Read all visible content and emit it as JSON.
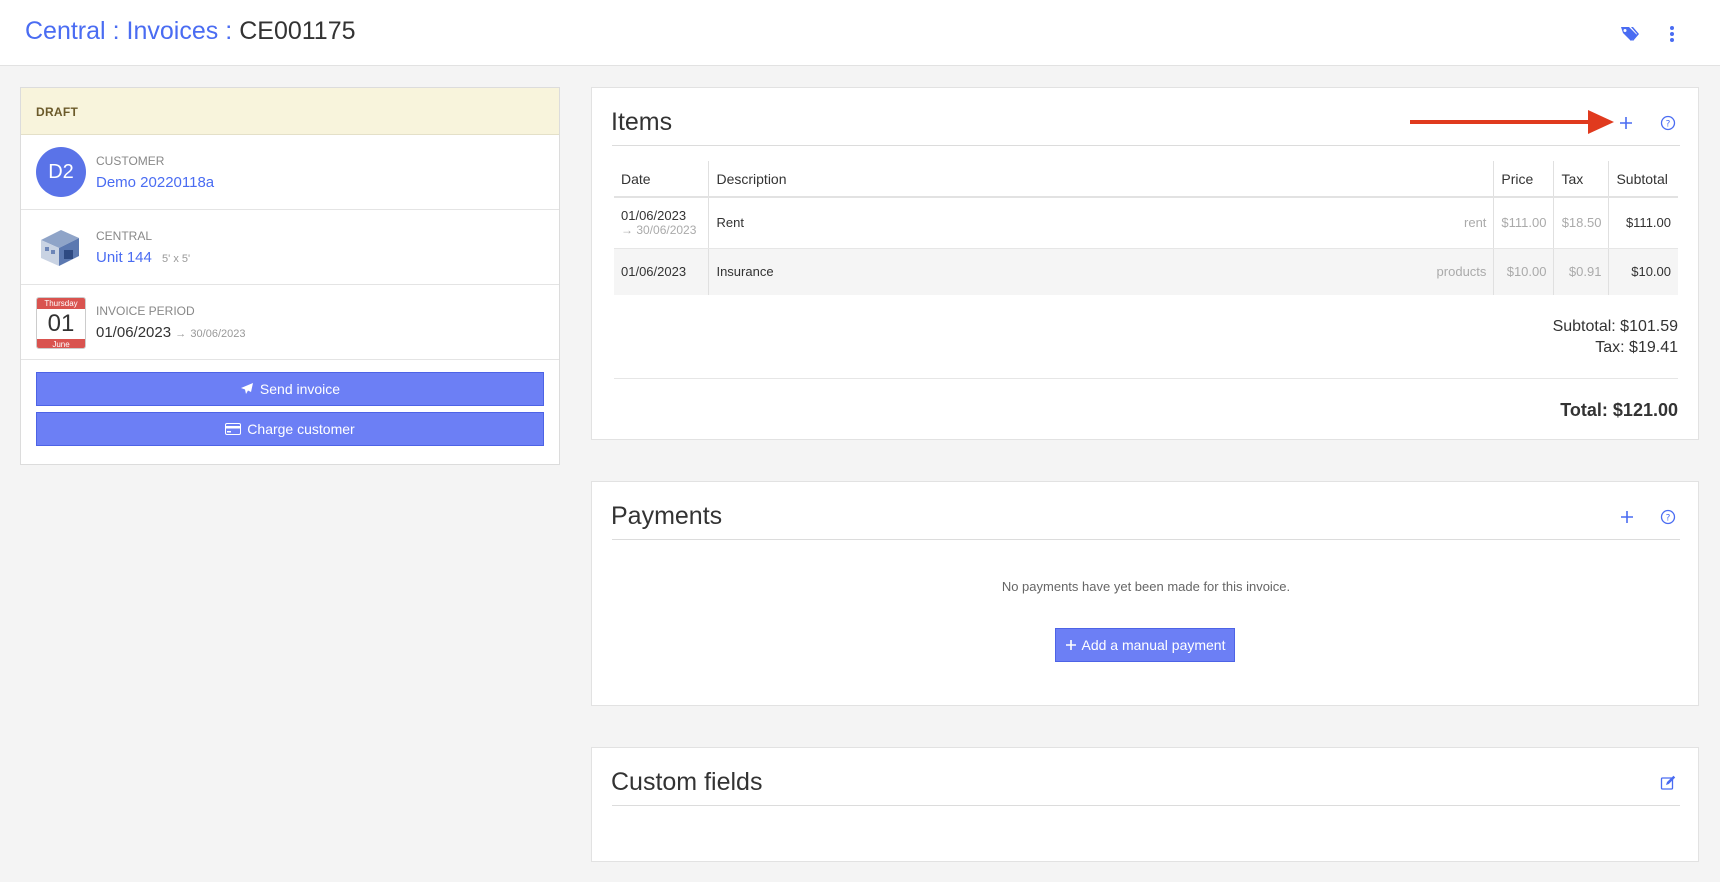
{
  "header": {
    "crumb_1": "Central",
    "crumb_2": "Invoices",
    "separator": ":",
    "current": "CE001175",
    "accent": "#4a6cf2"
  },
  "sidebar": {
    "status": "DRAFT",
    "customer": {
      "label": "CUSTOMER",
      "initials": "D2",
      "name": "Demo 20220118a"
    },
    "unit": {
      "label": "CENTRAL",
      "name": "Unit 144",
      "size": "5' x 5'"
    },
    "period": {
      "label": "INVOICE PERIOD",
      "weekday": "Thursday",
      "day": "01",
      "month": "June",
      "start": "01/06/2023",
      "arrow": "→",
      "end": "30/06/2023"
    },
    "send_label": "Send invoice",
    "charge_label": "Charge customer"
  },
  "items": {
    "title": "Items",
    "columns": [
      "Date",
      "Description",
      "Price",
      "Tax",
      "Subtotal"
    ],
    "rows": [
      {
        "date": "01/06/2023",
        "date_end": "→ 30/06/2023",
        "description": "Rent",
        "category": "rent",
        "price": "$111.00",
        "tax": "$18.50",
        "subtotal": "$111.00"
      },
      {
        "date": "01/06/2023",
        "date_end": "",
        "description": "Insurance",
        "category": "products",
        "price": "$10.00",
        "tax": "$0.91",
        "subtotal": "$10.00"
      }
    ],
    "subtotal": "Subtotal: $101.59",
    "tax": "Tax: $19.41",
    "total": "Total: $121.00"
  },
  "payments": {
    "title": "Payments",
    "empty_message": "No payments have yet been made for this invoice.",
    "add_label": "Add a manual payment"
  },
  "custom_fields": {
    "title": "Custom fields"
  },
  "annotation": {
    "arrow_color": "#e03a1e"
  }
}
